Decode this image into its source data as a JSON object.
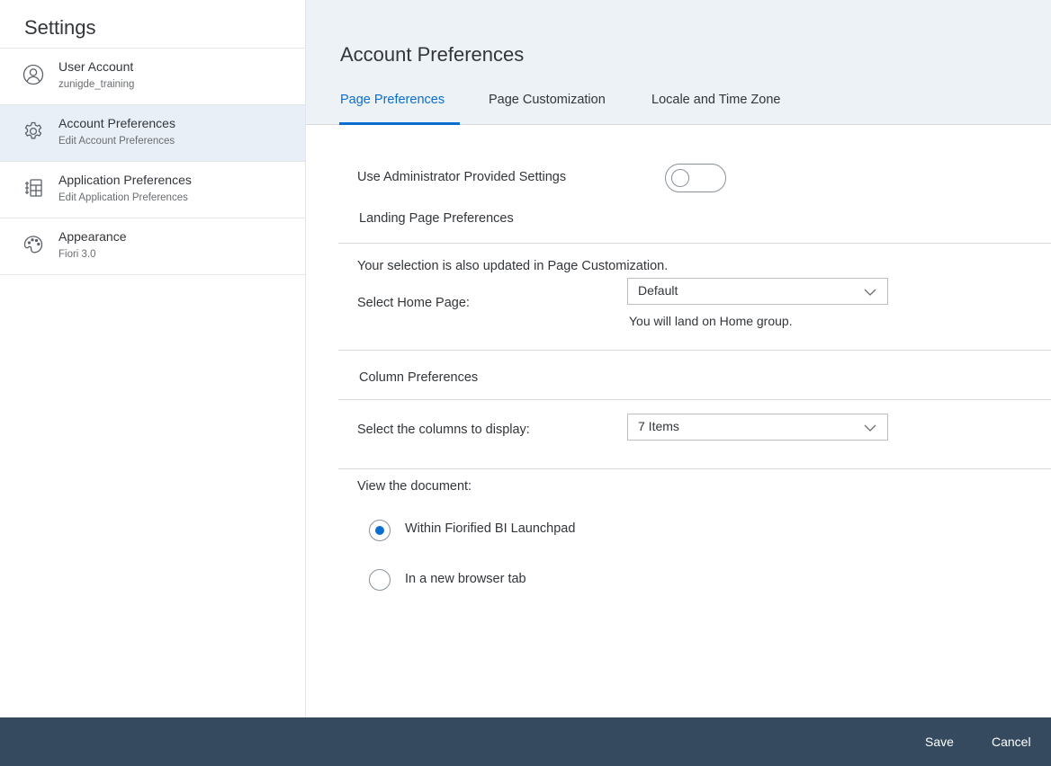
{
  "sidebar": {
    "title": "Settings",
    "items": [
      {
        "icon": "user-icon",
        "title": "User Account",
        "subtitle": "zunigde_training"
      },
      {
        "icon": "gear-icon",
        "title": "Account Preferences",
        "subtitle": "Edit Account Preferences",
        "selected": true
      },
      {
        "icon": "app-icon",
        "title": "Application Preferences",
        "subtitle": "Edit Application Preferences"
      },
      {
        "icon": "palette-icon",
        "title": "Appearance",
        "subtitle": "Fiori 3.0"
      }
    ]
  },
  "header": {
    "title": "Account Preferences",
    "tabs": [
      {
        "label": "Page Preferences",
        "active": true
      },
      {
        "label": "Page Customization"
      },
      {
        "label": "Locale and Time Zone"
      }
    ]
  },
  "content": {
    "admin_settings_label": "Use Administrator Provided Settings",
    "admin_settings_enabled": false,
    "landing_section": "Landing Page Preferences",
    "landing_note": "Your selection is also updated in Page Customization.",
    "home_page_label": "Select Home Page:",
    "home_page_value": "Default",
    "home_page_hint": "You will land on Home group.",
    "column_section": "Column Preferences",
    "columns_label": "Select the columns to display:",
    "columns_value": "7 Items",
    "view_doc_label": "View the document:",
    "view_options": [
      {
        "label": "Within Fiorified BI Launchpad",
        "selected": true
      },
      {
        "label": "In a new browser tab",
        "selected": false
      }
    ]
  },
  "footer": {
    "save_label": "Save",
    "cancel_label": "Cancel"
  },
  "colors": {
    "accent": "#0a6ed1",
    "footer_bg": "#354a5f",
    "header_bg": "#edf2f7",
    "selected_bg": "#e8eff6"
  }
}
